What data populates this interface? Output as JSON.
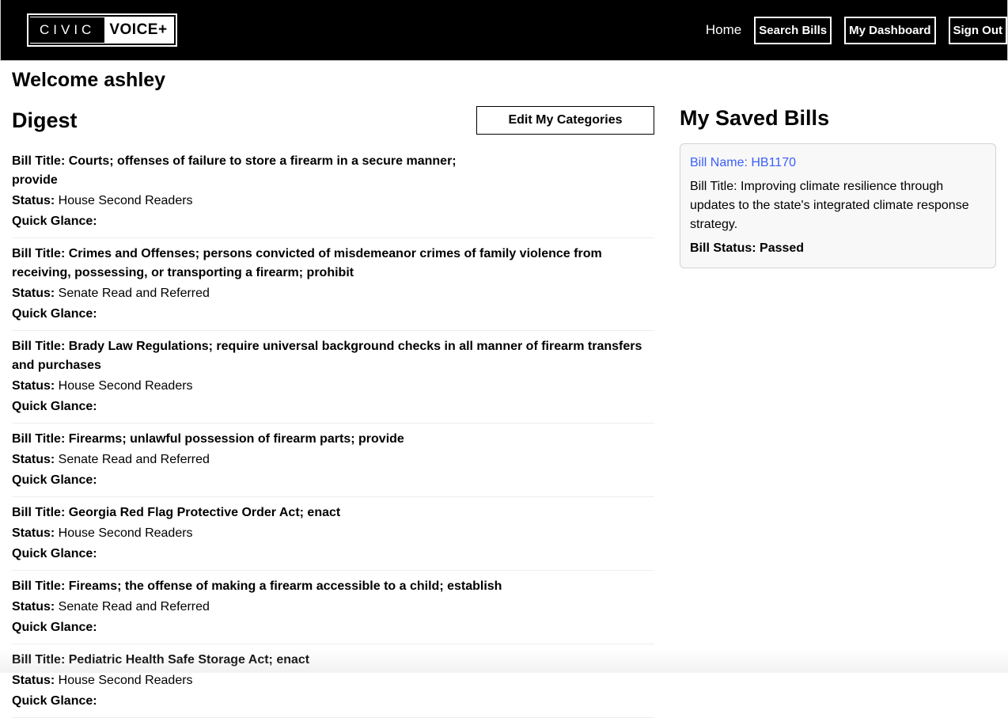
{
  "header": {
    "logo_civic": "CIVIC",
    "logo_voice": "VOICE+",
    "nav": {
      "home": "Home",
      "search_bills": "Search Bills",
      "my_dashboard": "My Dashboard",
      "sign_out": "Sign Out"
    }
  },
  "welcome": "Welcome ashley",
  "digest": {
    "title": "Digest",
    "edit_button": "Edit My Categories",
    "bill_title_prefix": "Bill Title: ",
    "status_prefix": "Status: ",
    "quick_glance_label": "Quick Glance:",
    "items": [
      {
        "title": "Courts; offenses of failure to store a firearm in a secure manner; provide",
        "status": "House Second Readers"
      },
      {
        "title": "Crimes and Offenses; persons convicted of misdemeanor crimes of family violence from receiving, possessing, or transporting a firearm; prohibit",
        "status": "Senate Read and Referred"
      },
      {
        "title": "Brady Law Regulations; require universal background checks in all manner of firearm transfers and purchases",
        "status": "House Second Readers"
      },
      {
        "title": "Firearms; unlawful possession of firearm parts; provide",
        "status": "Senate Read and Referred"
      },
      {
        "title": "Georgia Red Flag Protective Order Act; enact",
        "status": "House Second Readers"
      },
      {
        "title": "Fireams; the offense of making a firearm accessible to a child; establish",
        "status": "Senate Read and Referred"
      },
      {
        "title": "Pediatric Health Safe Storage Act; enact",
        "status": "House Second Readers"
      }
    ]
  },
  "saved": {
    "title": "My Saved Bills",
    "bill_name_prefix": "Bill Name: ",
    "bill_title_prefix": "Bill Title: ",
    "bill_status_prefix": "Bill Status: ",
    "items": [
      {
        "name": "HB1170",
        "title": "Improving climate resilience through updates to the state's integrated climate response strategy.",
        "status": "Passed"
      }
    ]
  }
}
